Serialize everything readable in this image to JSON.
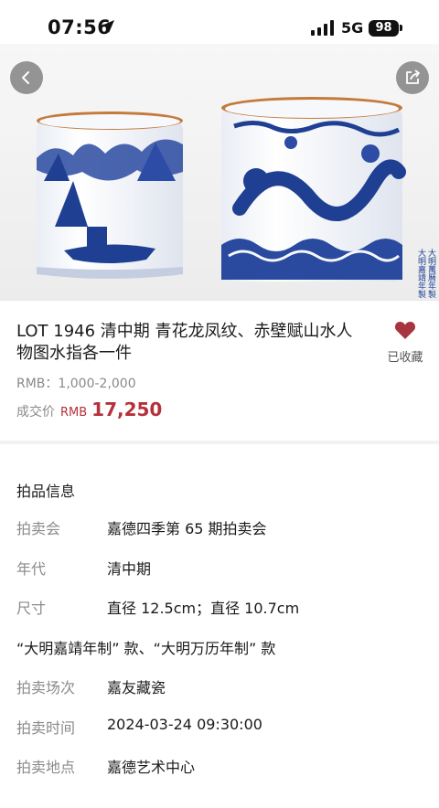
{
  "status_bar": {
    "time": "07:56",
    "network": "5G",
    "battery": "98"
  },
  "hero": {
    "seal_marks": [
      "大",
      "明",
      "萬",
      "曆",
      "年",
      "製",
      "大",
      "明",
      "嘉",
      "靖",
      "年",
      "製"
    ]
  },
  "lot": {
    "title": "LOT 1946 清中期  青花龙凤纹、赤壁赋山水人物图水指各一件",
    "favorite_label": "已收藏",
    "estimate": "RMB：1,000-2,000",
    "price_label": "成交价",
    "price_currency": "RMB",
    "price_value": "17,250"
  },
  "info": {
    "section_title": "拍品信息",
    "rows": [
      {
        "key": "拍卖会",
        "value": "嘉德四季第 65 期拍卖会"
      },
      {
        "key": "年代",
        "value": "清中期"
      },
      {
        "key": "尺寸",
        "value": "直径 12.5cm；直径 10.7cm"
      }
    ],
    "mark_line": "“大明嘉靖年制” 款、“大明万历年制” 款",
    "rows2": [
      {
        "key": "拍卖场次",
        "value": "嘉友藏瓷"
      },
      {
        "key": "拍卖时间",
        "value": "2024-03-24 09:30:00"
      },
      {
        "key": "拍卖地点",
        "value": "嘉德艺术中心"
      }
    ]
  },
  "colors": {
    "accent_red": "#b5313b",
    "heart": "#a83440",
    "text_muted": "#8a8a8a",
    "porcelain_blue": "#1f3f93"
  }
}
